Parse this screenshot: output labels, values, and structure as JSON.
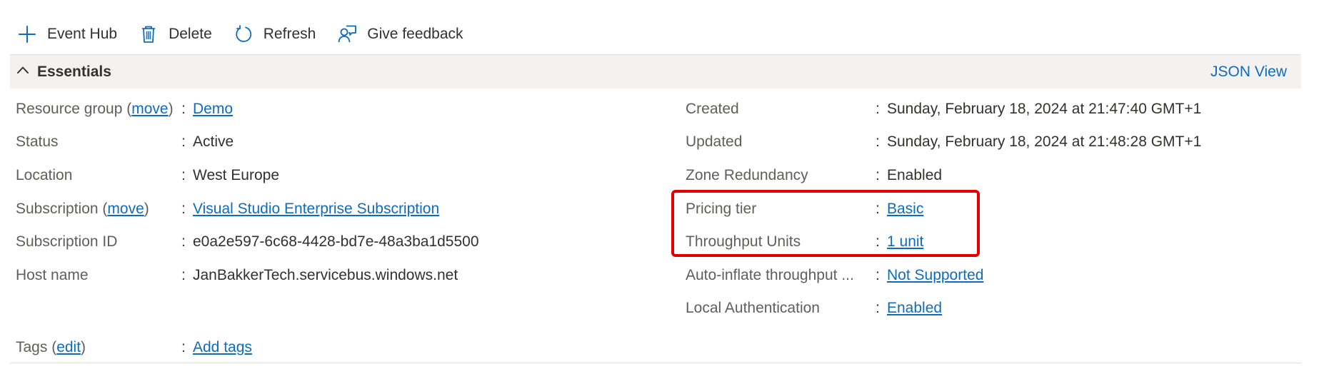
{
  "toolbar": {
    "event_hub_label": "Event Hub",
    "delete_label": "Delete",
    "refresh_label": "Refresh",
    "feedback_label": "Give feedback"
  },
  "essentials": {
    "title": "Essentials",
    "json_view_label": "JSON View"
  },
  "left": {
    "resource_group": {
      "label": "Resource group (",
      "label_link": "move",
      "label_close": ")",
      "value": "Demo"
    },
    "status": {
      "label": "Status",
      "value": "Active"
    },
    "location": {
      "label": "Location",
      "value": "West Europe"
    },
    "subscription": {
      "label": "Subscription (",
      "label_link": "move",
      "label_close": ")",
      "value": "Visual Studio Enterprise Subscription"
    },
    "subscription_id": {
      "label": "Subscription ID",
      "value": "e0a2e597-6c68-4428-bd7e-48a3ba1d5500"
    },
    "host_name": {
      "label": "Host name",
      "value": "JanBakkerTech.servicebus.windows.net"
    },
    "tags": {
      "label": "Tags (",
      "label_link": "edit",
      "label_close": ")",
      "value": "Add tags"
    }
  },
  "right": {
    "created": {
      "label": "Created",
      "value": "Sunday, February 18, 2024 at 21:47:40 GMT+1"
    },
    "updated": {
      "label": "Updated",
      "value": "Sunday, February 18, 2024 at 21:48:28 GMT+1"
    },
    "zone_redundancy": {
      "label": "Zone Redundancy",
      "value": "Enabled"
    },
    "pricing_tier": {
      "label": "Pricing tier",
      "value": "Basic"
    },
    "throughput_units": {
      "label": "Throughput Units",
      "value": "1 unit"
    },
    "auto_inflate": {
      "label": "Auto-inflate throughput ...",
      "value": "Not Supported"
    },
    "local_auth": {
      "label": "Local Authentication",
      "value": "Enabled"
    }
  },
  "colon": ":",
  "colors": {
    "link": "#0f6cbd",
    "highlight": "#e00000",
    "essentials_bg": "#f3f2f1"
  },
  "icons": {
    "add": "plus-icon",
    "delete": "trash-icon",
    "refresh": "refresh-icon",
    "feedback": "feedback-icon",
    "collapse": "chevron-up-icon"
  }
}
